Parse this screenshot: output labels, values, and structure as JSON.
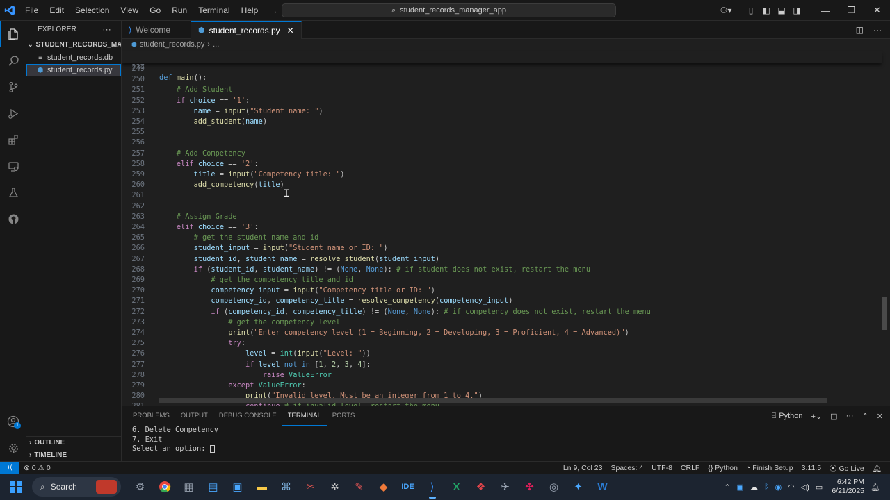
{
  "titlebar": {
    "menus": [
      "File",
      "Edit",
      "Selection",
      "View",
      "Go",
      "Run",
      "Terminal",
      "Help"
    ],
    "search_text": "student_records_manager_app"
  },
  "sidebar": {
    "title": "EXPLORER",
    "folder": "STUDENT_RECORDS_MAN...",
    "files": [
      "student_records.db",
      "student_records.py"
    ],
    "outline_label": "OUTLINE",
    "timeline_label": "TIMELINE"
  },
  "tabs": [
    {
      "label": "Welcome"
    },
    {
      "label": "student_records.py"
    }
  ],
  "breadcrumb": {
    "file": "student_records.py",
    "more": "..."
  },
  "sticky": {
    "num": "237",
    "code": "def main():"
  },
  "editor": {
    "lines": [
      {
        "num": "249",
        "tokens": [
          {
            "t": "",
            "c": "p"
          }
        ]
      },
      {
        "num": "250",
        "tokens": [
          {
            "t": "",
            "c": "p"
          }
        ]
      },
      {
        "num": "251",
        "tokens": [
          {
            "t": "    # Add Student",
            "c": "c"
          }
        ]
      },
      {
        "num": "252",
        "tokens": [
          {
            "t": "    ",
            "c": "p"
          },
          {
            "t": "if",
            "c": "k"
          },
          {
            "t": " choice",
            "c": "v"
          },
          {
            "t": " == ",
            "c": "p"
          },
          {
            "t": "'1'",
            "c": "s"
          },
          {
            "t": ":",
            "c": "p"
          }
        ]
      },
      {
        "num": "253",
        "tokens": [
          {
            "t": "        name",
            "c": "v"
          },
          {
            "t": " = ",
            "c": "p"
          },
          {
            "t": "input",
            "c": "f"
          },
          {
            "t": "(",
            "c": "p"
          },
          {
            "t": "\"Student name: \"",
            "c": "s"
          },
          {
            "t": ")",
            "c": "p"
          }
        ]
      },
      {
        "num": "254",
        "tokens": [
          {
            "t": "        add_student",
            "c": "f"
          },
          {
            "t": "(",
            "c": "p"
          },
          {
            "t": "name",
            "c": "v"
          },
          {
            "t": ")",
            "c": "p"
          }
        ]
      },
      {
        "num": "255",
        "tokens": [
          {
            "t": "",
            "c": "p"
          }
        ]
      },
      {
        "num": "256",
        "tokens": [
          {
            "t": "",
            "c": "p"
          }
        ]
      },
      {
        "num": "257",
        "tokens": [
          {
            "t": "    # Add Competency",
            "c": "c"
          }
        ]
      },
      {
        "num": "258",
        "tokens": [
          {
            "t": "    ",
            "c": "p"
          },
          {
            "t": "elif",
            "c": "k"
          },
          {
            "t": " choice",
            "c": "v"
          },
          {
            "t": " == ",
            "c": "p"
          },
          {
            "t": "'2'",
            "c": "s"
          },
          {
            "t": ":",
            "c": "p"
          }
        ]
      },
      {
        "num": "259",
        "tokens": [
          {
            "t": "        title",
            "c": "v"
          },
          {
            "t": " = ",
            "c": "p"
          },
          {
            "t": "input",
            "c": "f"
          },
          {
            "t": "(",
            "c": "p"
          },
          {
            "t": "\"Competency title: \"",
            "c": "s"
          },
          {
            "t": ")",
            "c": "p"
          }
        ]
      },
      {
        "num": "260",
        "tokens": [
          {
            "t": "        add_competency",
            "c": "f"
          },
          {
            "t": "(",
            "c": "p"
          },
          {
            "t": "title",
            "c": "v"
          },
          {
            "t": ")",
            "c": "p"
          }
        ]
      },
      {
        "num": "261",
        "tokens": [
          {
            "t": "",
            "c": "p"
          }
        ]
      },
      {
        "num": "262",
        "tokens": [
          {
            "t": "",
            "c": "p"
          }
        ]
      },
      {
        "num": "263",
        "tokens": [
          {
            "t": "    # Assign Grade",
            "c": "c"
          }
        ]
      },
      {
        "num": "264",
        "tokens": [
          {
            "t": "    ",
            "c": "p"
          },
          {
            "t": "elif",
            "c": "k"
          },
          {
            "t": " choice",
            "c": "v"
          },
          {
            "t": " == ",
            "c": "p"
          },
          {
            "t": "'3'",
            "c": "s"
          },
          {
            "t": ":",
            "c": "p"
          }
        ]
      },
      {
        "num": "265",
        "tokens": [
          {
            "t": "        # get the student name and id",
            "c": "c"
          }
        ]
      },
      {
        "num": "266",
        "tokens": [
          {
            "t": "        student_input",
            "c": "v"
          },
          {
            "t": " = ",
            "c": "p"
          },
          {
            "t": "input",
            "c": "f"
          },
          {
            "t": "(",
            "c": "p"
          },
          {
            "t": "\"Student name or ID: \"",
            "c": "s"
          },
          {
            "t": ")",
            "c": "p"
          }
        ]
      },
      {
        "num": "267",
        "tokens": [
          {
            "t": "        student_id",
            "c": "v"
          },
          {
            "t": ", ",
            "c": "p"
          },
          {
            "t": "student_name",
            "c": "v"
          },
          {
            "t": " = ",
            "c": "p"
          },
          {
            "t": "resolve_student",
            "c": "f"
          },
          {
            "t": "(",
            "c": "p"
          },
          {
            "t": "student_input",
            "c": "v"
          },
          {
            "t": ")",
            "c": "p"
          }
        ]
      },
      {
        "num": "268",
        "tokens": [
          {
            "t": "        ",
            "c": "p"
          },
          {
            "t": "if",
            "c": "k"
          },
          {
            "t": " (",
            "c": "p"
          },
          {
            "t": "student_id",
            "c": "v"
          },
          {
            "t": ", ",
            "c": "p"
          },
          {
            "t": "student_name",
            "c": "v"
          },
          {
            "t": ") != (",
            "c": "p"
          },
          {
            "t": "None",
            "c": "kb"
          },
          {
            "t": ", ",
            "c": "p"
          },
          {
            "t": "None",
            "c": "kb"
          },
          {
            "t": "): ",
            "c": "p"
          },
          {
            "t": "# if student does not exist, restart the menu",
            "c": "c"
          }
        ]
      },
      {
        "num": "269",
        "tokens": [
          {
            "t": "            # get the competency title and id",
            "c": "c"
          }
        ]
      },
      {
        "num": "270",
        "tokens": [
          {
            "t": "            competency_input",
            "c": "v"
          },
          {
            "t": " = ",
            "c": "p"
          },
          {
            "t": "input",
            "c": "f"
          },
          {
            "t": "(",
            "c": "p"
          },
          {
            "t": "\"Competency title or ID: \"",
            "c": "s"
          },
          {
            "t": ")",
            "c": "p"
          }
        ]
      },
      {
        "num": "271",
        "tokens": [
          {
            "t": "            competency_id",
            "c": "v"
          },
          {
            "t": ", ",
            "c": "p"
          },
          {
            "t": "competency_title",
            "c": "v"
          },
          {
            "t": " = ",
            "c": "p"
          },
          {
            "t": "resolve_competency",
            "c": "f"
          },
          {
            "t": "(",
            "c": "p"
          },
          {
            "t": "competency_input",
            "c": "v"
          },
          {
            "t": ")",
            "c": "p"
          }
        ]
      },
      {
        "num": "272",
        "tokens": [
          {
            "t": "            ",
            "c": "p"
          },
          {
            "t": "if",
            "c": "k"
          },
          {
            "t": " (",
            "c": "p"
          },
          {
            "t": "competency_id",
            "c": "v"
          },
          {
            "t": ", ",
            "c": "p"
          },
          {
            "t": "competency_title",
            "c": "v"
          },
          {
            "t": ") != (",
            "c": "p"
          },
          {
            "t": "None",
            "c": "kb"
          },
          {
            "t": ", ",
            "c": "p"
          },
          {
            "t": "None",
            "c": "kb"
          },
          {
            "t": "): ",
            "c": "p"
          },
          {
            "t": "# if competency does not exist, restart the menu",
            "c": "c"
          }
        ]
      },
      {
        "num": "273",
        "tokens": [
          {
            "t": "                # get the competency level",
            "c": "c"
          }
        ]
      },
      {
        "num": "274",
        "tokens": [
          {
            "t": "                print",
            "c": "f"
          },
          {
            "t": "(",
            "c": "p"
          },
          {
            "t": "\"Enter competency level (1 = Beginning, 2 = Developing, 3 = Proficient, 4 = Advanced)\"",
            "c": "s"
          },
          {
            "t": ")",
            "c": "p"
          }
        ]
      },
      {
        "num": "275",
        "tokens": [
          {
            "t": "                ",
            "c": "p"
          },
          {
            "t": "try",
            "c": "k"
          },
          {
            "t": ":",
            "c": "p"
          }
        ]
      },
      {
        "num": "276",
        "tokens": [
          {
            "t": "                    level",
            "c": "v"
          },
          {
            "t": " = ",
            "c": "p"
          },
          {
            "t": "int",
            "c": "t"
          },
          {
            "t": "(",
            "c": "p"
          },
          {
            "t": "input",
            "c": "f"
          },
          {
            "t": "(",
            "c": "p"
          },
          {
            "t": "\"Level: \"",
            "c": "s"
          },
          {
            "t": "))",
            "c": "p"
          }
        ]
      },
      {
        "num": "277",
        "tokens": [
          {
            "t": "                    ",
            "c": "p"
          },
          {
            "t": "if",
            "c": "k"
          },
          {
            "t": " level",
            "c": "v"
          },
          {
            "t": " not in",
            "c": "kb"
          },
          {
            "t": " [",
            "c": "p"
          },
          {
            "t": "1",
            "c": "n"
          },
          {
            "t": ", ",
            "c": "p"
          },
          {
            "t": "2",
            "c": "n"
          },
          {
            "t": ", ",
            "c": "p"
          },
          {
            "t": "3",
            "c": "n"
          },
          {
            "t": ", ",
            "c": "p"
          },
          {
            "t": "4",
            "c": "n"
          },
          {
            "t": "]:",
            "c": "p"
          }
        ]
      },
      {
        "num": "278",
        "tokens": [
          {
            "t": "                        ",
            "c": "p"
          },
          {
            "t": "raise",
            "c": "k"
          },
          {
            "t": " ValueError",
            "c": "t"
          }
        ]
      },
      {
        "num": "279",
        "tokens": [
          {
            "t": "                ",
            "c": "p"
          },
          {
            "t": "except",
            "c": "k"
          },
          {
            "t": " ValueError",
            "c": "t"
          },
          {
            "t": ":",
            "c": "p"
          }
        ]
      },
      {
        "num": "280",
        "tokens": [
          {
            "t": "                    print",
            "c": "f"
          },
          {
            "t": "(",
            "c": "p"
          },
          {
            "t": "\"Invalid level. Must be an integer from 1 to 4.\"",
            "c": "s"
          },
          {
            "t": ")",
            "c": "p"
          }
        ]
      },
      {
        "num": "281",
        "tokens": [
          {
            "t": "                    ",
            "c": "p"
          },
          {
            "t": "continue",
            "c": "k"
          },
          {
            "t": " # if invalid level, restart the menu",
            "c": "c"
          }
        ]
      }
    ]
  },
  "panel": {
    "tabs": [
      "PROBLEMS",
      "OUTPUT",
      "DEBUG CONSOLE",
      "TERMINAL",
      "PORTS"
    ],
    "shell_label": "Python",
    "terminal_lines": [
      "6. Delete Competency",
      "7. Exit",
      "Select an option: "
    ]
  },
  "statusbar": {
    "errors": "0",
    "warnings": "0",
    "position": "Ln 9, Col 23",
    "spaces": "Spaces: 4",
    "encoding": "UTF-8",
    "eol": "CRLF",
    "language": "Python",
    "finish_setup": "Finish Setup",
    "version": "3.11.5",
    "golive": "Go Live"
  },
  "taskbar": {
    "search_label": "Search",
    "time": "6:42 PM",
    "date": "6/21/2025"
  },
  "colors": {
    "accent": "#0078d4",
    "editor_bg": "#1f1f1f",
    "chrome_bg": "#181818"
  }
}
